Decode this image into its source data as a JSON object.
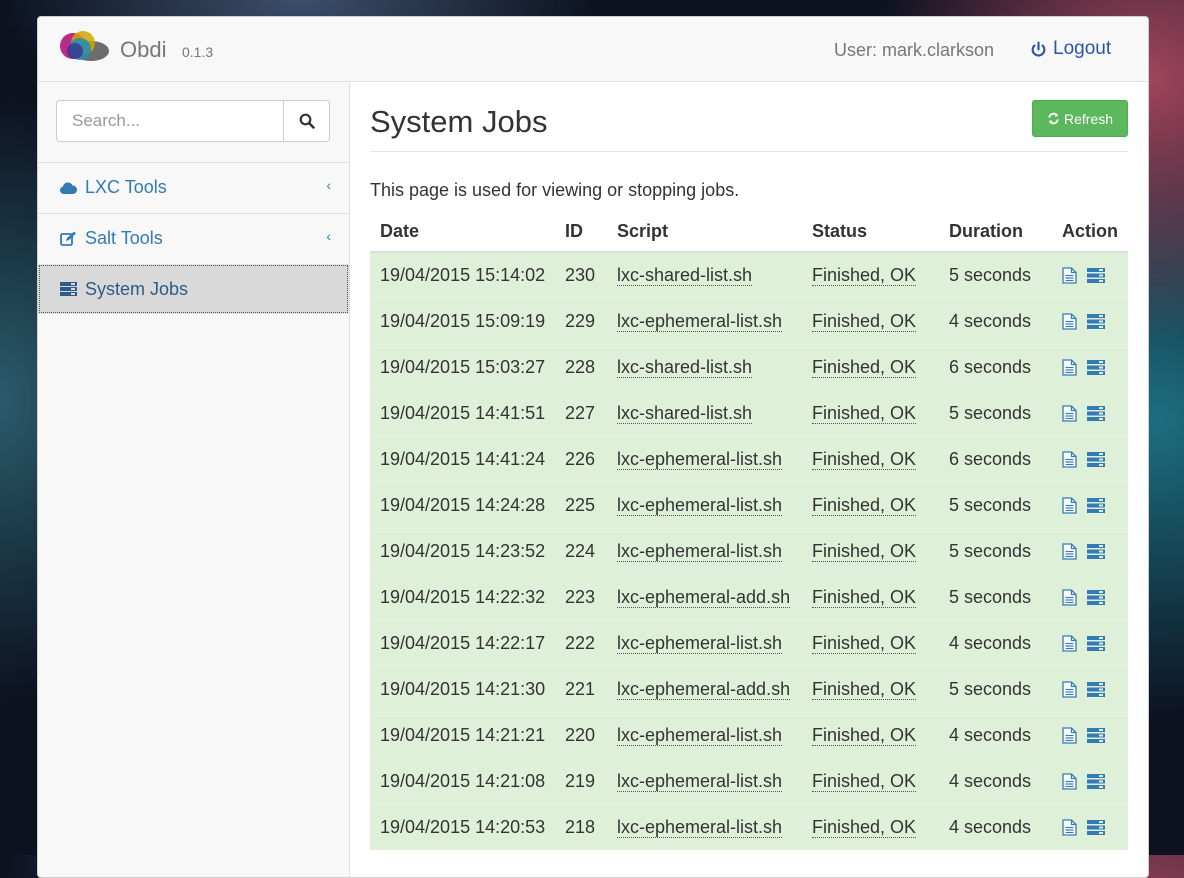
{
  "app": {
    "brand": "Obdi",
    "version": "0.1.3"
  },
  "header": {
    "user_text": "User: mark.clarkson",
    "logout_label": "Logout"
  },
  "sidebar": {
    "search_placeholder": "Search...",
    "items": [
      {
        "label": "LXC Tools",
        "icon": "cloud-icon",
        "chevron": "‹",
        "active": false
      },
      {
        "label": "Salt Tools",
        "icon": "edit-icon",
        "chevron": "‹",
        "active": false
      },
      {
        "label": "System Jobs",
        "icon": "server-icon",
        "active": true
      }
    ]
  },
  "main": {
    "title": "System Jobs",
    "refresh_label": "Refresh",
    "description": "This page is used for viewing or stopping jobs.",
    "columns": [
      "Date",
      "ID",
      "Script",
      "Status",
      "Duration",
      "Action"
    ],
    "rows": [
      {
        "date": "19/04/2015 15:14:02",
        "id": "230",
        "script": "lxc-shared-list.sh",
        "status": "Finished, OK",
        "duration": "5 seconds"
      },
      {
        "date": "19/04/2015 15:09:19",
        "id": "229",
        "script": "lxc-ephemeral-list.sh",
        "status": "Finished, OK",
        "duration": "4 seconds"
      },
      {
        "date": "19/04/2015 15:03:27",
        "id": "228",
        "script": "lxc-shared-list.sh",
        "status": "Finished, OK",
        "duration": "6 seconds"
      },
      {
        "date": "19/04/2015 14:41:51",
        "id": "227",
        "script": "lxc-shared-list.sh",
        "status": "Finished, OK",
        "duration": "5 seconds"
      },
      {
        "date": "19/04/2015 14:41:24",
        "id": "226",
        "script": "lxc-ephemeral-list.sh",
        "status": "Finished, OK",
        "duration": "6 seconds"
      },
      {
        "date": "19/04/2015 14:24:28",
        "id": "225",
        "script": "lxc-ephemeral-list.sh",
        "status": "Finished, OK",
        "duration": "5 seconds"
      },
      {
        "date": "19/04/2015 14:23:52",
        "id": "224",
        "script": "lxc-ephemeral-list.sh",
        "status": "Finished, OK",
        "duration": "5 seconds"
      },
      {
        "date": "19/04/2015 14:22:32",
        "id": "223",
        "script": "lxc-ephemeral-add.sh",
        "status": "Finished, OK",
        "duration": "5 seconds"
      },
      {
        "date": "19/04/2015 14:22:17",
        "id": "222",
        "script": "lxc-ephemeral-list.sh",
        "status": "Finished, OK",
        "duration": "4 seconds"
      },
      {
        "date": "19/04/2015 14:21:30",
        "id": "221",
        "script": "lxc-ephemeral-add.sh",
        "status": "Finished, OK",
        "duration": "5 seconds"
      },
      {
        "date": "19/04/2015 14:21:21",
        "id": "220",
        "script": "lxc-ephemeral-list.sh",
        "status": "Finished, OK",
        "duration": "4 seconds"
      },
      {
        "date": "19/04/2015 14:21:08",
        "id": "219",
        "script": "lxc-ephemeral-list.sh",
        "status": "Finished, OK",
        "duration": "4 seconds"
      },
      {
        "date": "19/04/2015 14:20:53",
        "id": "218",
        "script": "lxc-ephemeral-list.sh",
        "status": "Finished, OK",
        "duration": "4 seconds"
      }
    ]
  },
  "colors": {
    "accent": "#337ab7",
    "success": "#5cb85c",
    "row_success": "#dff0d8",
    "logout": "#2b55a6"
  }
}
